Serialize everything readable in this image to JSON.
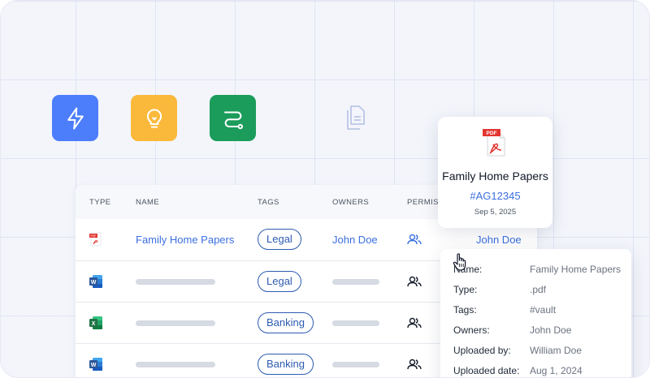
{
  "tiles": [
    {
      "name": "lightning",
      "color": "#4c7dfb"
    },
    {
      "name": "lightbulb",
      "color": "#fbb93b"
    },
    {
      "name": "route",
      "color": "#1b9c5b"
    }
  ],
  "table": {
    "headers": {
      "type": "TYPE",
      "name": "NAME",
      "tags": "TAGS",
      "owners": "OWNERS",
      "permissions": "PERMISS"
    },
    "rows": [
      {
        "type_icon": "pdf-icon",
        "name": "Family Home Papers",
        "tag": "Legal",
        "owner": "John Doe",
        "owner_extra": "John Doe"
      },
      {
        "type_icon": "word-icon",
        "name": "",
        "tag": "Legal",
        "owner": ""
      },
      {
        "type_icon": "excel-icon",
        "name": "",
        "tag": "Banking",
        "owner": ""
      },
      {
        "type_icon": "word-icon",
        "name": "",
        "tag": "Banking",
        "owner": ""
      }
    ]
  },
  "pdf_card": {
    "badge": "PDF",
    "title": "Family Home Papers",
    "code": "#AG12345",
    "date": "Sep 5, 2025"
  },
  "details": {
    "rows": [
      {
        "key": "Name:",
        "value": "Family Home Papers"
      },
      {
        "key": "Type:",
        "value": ".pdf"
      },
      {
        "key": "Tags:",
        "value": "#vault"
      },
      {
        "key": "Owners:",
        "value": "John Doe"
      },
      {
        "key": "Uploaded by:",
        "value": "William Doe"
      },
      {
        "key": "Uploaded date:",
        "value": "Aug 1, 2024"
      }
    ]
  },
  "colors": {
    "accent": "#3b6fe0",
    "tag_border": "#2d5bb0",
    "pdf_red": "#e3342f",
    "word_blue": "#2b579a",
    "excel_green": "#217346"
  }
}
